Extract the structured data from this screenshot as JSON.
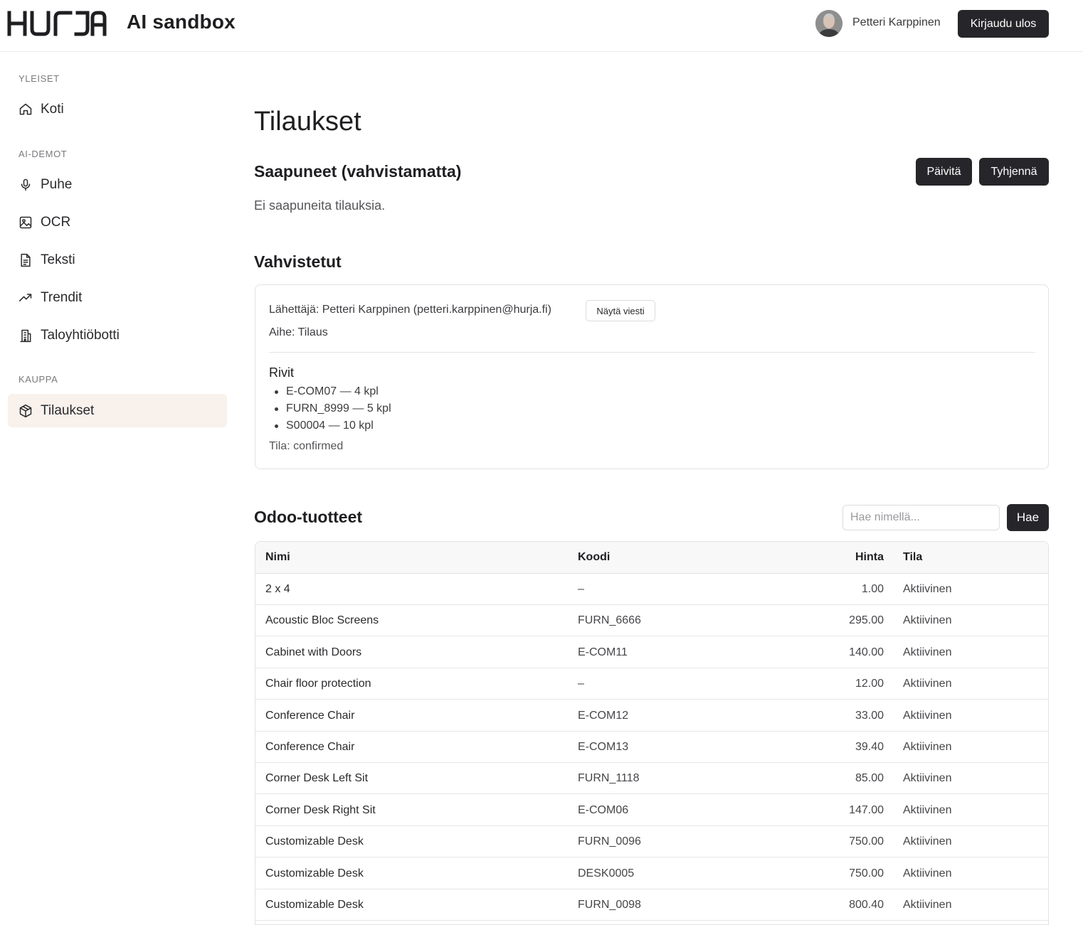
{
  "header": {
    "app_title": "AI sandbox",
    "logo_text": "HURJA",
    "user_name": "Petteri Karppinen",
    "logout_label": "Kirjaudu ulos"
  },
  "sidebar": {
    "sections": [
      {
        "label": "YLEISET"
      },
      {
        "label": "AI-DEMOT"
      },
      {
        "label": "KAUPPA"
      }
    ],
    "items": [
      {
        "label": "Koti",
        "icon": "home-icon"
      },
      {
        "label": "Puhe",
        "icon": "microphone-icon"
      },
      {
        "label": "OCR",
        "icon": "image-icon"
      },
      {
        "label": "Teksti",
        "icon": "document-icon"
      },
      {
        "label": "Trendit",
        "icon": "trending-up-icon"
      },
      {
        "label": "Taloyhtiöbotti",
        "icon": "building-icon"
      },
      {
        "label": "Tilaukset",
        "icon": "package-icon",
        "active": true
      }
    ]
  },
  "main": {
    "page_title": "Tilaukset",
    "incoming": {
      "title": "Saapuneet (vahvistamatta)",
      "refresh_label": "Päivitä",
      "clear_label": "Tyhjennä",
      "empty_text": "Ei saapuneita tilauksia."
    },
    "confirmed": {
      "title": "Vahvistetut",
      "order": {
        "sender": "Lähettäjä: Petteri Karppinen (petteri.karppinen@hurja.fi)",
        "show_message_label": "Näytä viesti",
        "subject": "Aihe: Tilaus",
        "rows_title": "Rivit",
        "rows": [
          "E-COM07 — 4 kpl",
          "FURN_8999 — 5 kpl",
          "S00004 — 10 kpl"
        ],
        "status": "Tila: confirmed"
      }
    },
    "products": {
      "title": "Odoo-tuotteet",
      "search_placeholder": "Hae nimellä...",
      "search_label": "Hae",
      "columns": {
        "name": "Nimi",
        "code": "Koodi",
        "price": "Hinta",
        "state": "Tila"
      },
      "rows": [
        {
          "name": "2 x 4",
          "code": "–",
          "price": "1.00",
          "state": "Aktiivinen"
        },
        {
          "name": "Acoustic Bloc Screens",
          "code": "FURN_6666",
          "price": "295.00",
          "state": "Aktiivinen"
        },
        {
          "name": "Cabinet with Doors",
          "code": "E-COM11",
          "price": "140.00",
          "state": "Aktiivinen"
        },
        {
          "name": "Chair floor protection",
          "code": "–",
          "price": "12.00",
          "state": "Aktiivinen"
        },
        {
          "name": "Conference Chair",
          "code": "E-COM12",
          "price": "33.00",
          "state": "Aktiivinen"
        },
        {
          "name": "Conference Chair",
          "code": "E-COM13",
          "price": "39.40",
          "state": "Aktiivinen"
        },
        {
          "name": "Corner Desk Left Sit",
          "code": "FURN_1118",
          "price": "85.00",
          "state": "Aktiivinen"
        },
        {
          "name": "Corner Desk Right Sit",
          "code": "E-COM06",
          "price": "147.00",
          "state": "Aktiivinen"
        },
        {
          "name": "Customizable Desk",
          "code": "FURN_0096",
          "price": "750.00",
          "state": "Aktiivinen"
        },
        {
          "name": "Customizable Desk",
          "code": "DESK0005",
          "price": "750.00",
          "state": "Aktiivinen"
        },
        {
          "name": "Customizable Desk",
          "code": "FURN_0098",
          "price": "800.40",
          "state": "Aktiivinen"
        }
      ]
    }
  },
  "colors": {
    "primary_button": "#26262a",
    "active_nav_bg": "#f8f1ec",
    "border": "#e2e2e4",
    "table_header_bg": "#f8f8f9"
  }
}
